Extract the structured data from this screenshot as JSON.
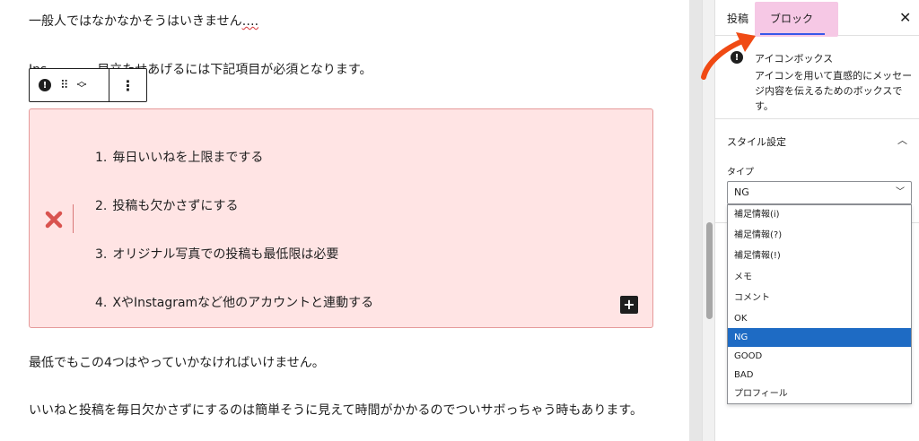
{
  "editor": {
    "paragraph_1": "一般人ではなかなかそうはいきません",
    "paragraph_1_suffix": "….",
    "paragraph_2": "Ins　　　　目立たせあげるには下記項目が必須となります。",
    "paragraph_3": "最低でもこの4つはやっていかなければいけません。",
    "paragraph_4": "いいねと投稿を毎日欠かさずにするのは簡単そうに見えて時間がかかるのでついサボっちゃう時もあります。"
  },
  "icon_box": {
    "items": [
      {
        "num": "1.",
        "text": "毎日いいねを上限までする"
      },
      {
        "num": "2.",
        "text": "投稿も欠かさずにする"
      },
      {
        "num": "3.",
        "text": "オリジナル写真での投稿も最低限は必要"
      },
      {
        "num": "4.",
        "text": "XやInstagramなど他のアカウントと連動する"
      }
    ],
    "icon": "cross-icon",
    "icon_color": "#d9534f",
    "background_color": "#ffe4e4",
    "border_color": "#e59a9a"
  },
  "toolbar": {
    "block_type_icon": "exclamation-icon",
    "drag_icon": "drag-handle-icon",
    "move_icon": "move-up-down-icon",
    "options_icon": "more-options-icon",
    "options_label": "⋮"
  },
  "sidebar": {
    "tabs": [
      {
        "label": "投稿"
      },
      {
        "label": "ブロック"
      }
    ],
    "active_tab": "ブロック",
    "close_label": "✕",
    "block_card": {
      "title": "アイコンボックス",
      "description": "アイコンを用いて直感的にメッセージ内容を伝えるためのボックスです。"
    },
    "style_panel": {
      "title": "スタイル設定",
      "type_label": "タイプ",
      "selected_value": "NG",
      "options": [
        "補足情報(i)",
        "補足情報(?)",
        "補足情報(!)",
        "メモ",
        "コメント",
        "OK",
        "NG",
        "GOOD",
        "BAD",
        "プロフィール"
      ]
    }
  },
  "colors": {
    "accent": "#3858e9",
    "selected_option": "#1e6bc4",
    "tab_highlight": "#f6c8e5",
    "annotation_arrow": "#f04a14"
  }
}
